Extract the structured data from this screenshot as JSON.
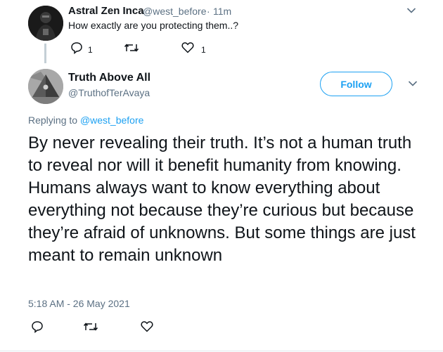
{
  "parent_tweet": {
    "author_name": "Astral Zen Inca",
    "handle": "@west_before",
    "separator": "·",
    "time": "11m",
    "text": "How exactly are you protecting them..?",
    "reply_count": "1",
    "like_count": "1"
  },
  "main_tweet": {
    "author_name": "Truth Above All",
    "handle": "@TruthofTerAvaya",
    "follow_label": "Follow",
    "replying_prefix": "Replying to",
    "replying_handle": "@west_before",
    "text": "By never revealing their truth. It’s not a human truth to reveal nor will it benefit humanity from knowing. Humans always want to know everything about everything not because they’re curious but because they’re afraid of unknowns. But some things are just meant to remain unknown",
    "timestamp": "5:18 AM - 26 May 2021"
  },
  "colors": {
    "accent": "#1da1f2",
    "muted": "#5b7083",
    "text": "#0f1419"
  }
}
